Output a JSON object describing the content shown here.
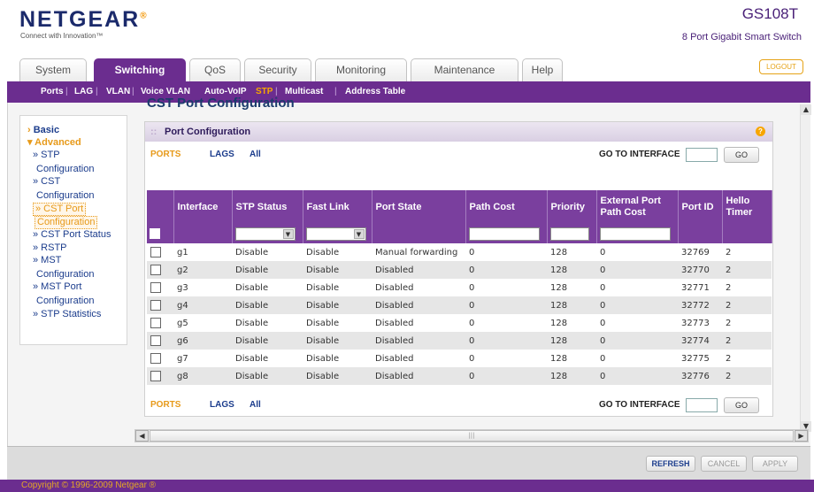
{
  "header": {
    "brand": "NETGEAR",
    "tagline": "Connect with Innovation™",
    "model": "GS108T",
    "model_desc": "8 Port Gigabit Smart Switch"
  },
  "tabs": [
    "System",
    "Switching",
    "QoS",
    "Security",
    "Monitoring",
    "Maintenance",
    "Help"
  ],
  "active_tab": "Switching",
  "logout_label": "LOGOUT",
  "subnav": [
    "Ports",
    "LAG",
    "VLAN",
    "Voice VLAN",
    "Auto-VoIP",
    "STP",
    "Multicast",
    "Address Table"
  ],
  "subnav_active": "STP",
  "sidebar": {
    "basic": "Basic",
    "advanced": "Advanced",
    "items": [
      "» STP",
      "Configuration",
      "» CST",
      "Configuration",
      "» CST Port",
      "Configuration",
      "» CST Port Status",
      "» RSTP",
      "» MST",
      "Configuration",
      "» MST Port",
      "Configuration",
      "» STP Statistics"
    ]
  },
  "page_title": "CST Port Configuration",
  "panel": {
    "title": "Port Configuration",
    "help": "?",
    "filters": [
      "PORTS",
      "LAGS",
      "All"
    ],
    "goto_label": "GO TO INTERFACE",
    "go_label": "GO"
  },
  "table": {
    "headers": [
      "Interface",
      "STP Status",
      "Fast Link",
      "Port State",
      "Path Cost",
      "Priority",
      "External Port Path Cost",
      "Port ID",
      "Hello Timer"
    ],
    "rows": [
      [
        "g1",
        "Disable",
        "Disable",
        "Manual forwarding",
        "0",
        "128",
        "0",
        "32769",
        "2"
      ],
      [
        "g2",
        "Disable",
        "Disable",
        "Disabled",
        "0",
        "128",
        "0",
        "32770",
        "2"
      ],
      [
        "g3",
        "Disable",
        "Disable",
        "Disabled",
        "0",
        "128",
        "0",
        "32771",
        "2"
      ],
      [
        "g4",
        "Disable",
        "Disable",
        "Disabled",
        "0",
        "128",
        "0",
        "32772",
        "2"
      ],
      [
        "g5",
        "Disable",
        "Disable",
        "Disabled",
        "0",
        "128",
        "0",
        "32773",
        "2"
      ],
      [
        "g6",
        "Disable",
        "Disable",
        "Disabled",
        "0",
        "128",
        "0",
        "32774",
        "2"
      ],
      [
        "g7",
        "Disable",
        "Disable",
        "Disabled",
        "0",
        "128",
        "0",
        "32775",
        "2"
      ],
      [
        "g8",
        "Disable",
        "Disable",
        "Disabled",
        "0",
        "128",
        "0",
        "32776",
        "2"
      ]
    ]
  },
  "actions": {
    "refresh": "REFRESH",
    "cancel": "CANCEL",
    "apply": "APPLY"
  },
  "footer": "Copyright © 1996-2009 Netgear ®",
  "colors": {
    "brand_purple": "#6b2d8f",
    "accent_orange": "#e79a1a",
    "navy": "#1b2a6b"
  }
}
